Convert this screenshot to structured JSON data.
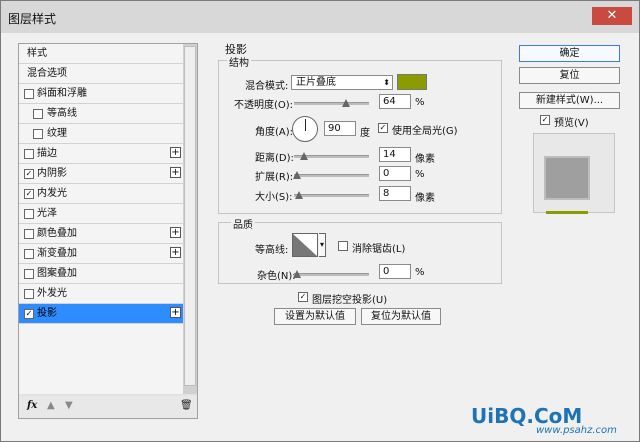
{
  "window": {
    "title": "图层样式",
    "close_symbol": "✕"
  },
  "sidebar": {
    "items": [
      {
        "label": "样式",
        "checkbox": false,
        "checked": false,
        "plus": false,
        "selected": false
      },
      {
        "label": "混合选项",
        "checkbox": false,
        "checked": false,
        "plus": false,
        "selected": false
      },
      {
        "label": "斜面和浮雕",
        "checkbox": true,
        "checked": false,
        "plus": false,
        "selected": false
      },
      {
        "label": "等高线",
        "checkbox": true,
        "checked": false,
        "plus": false,
        "selected": false,
        "indent": true
      },
      {
        "label": "纹理",
        "checkbox": true,
        "checked": false,
        "plus": false,
        "selected": false,
        "indent": true
      },
      {
        "label": "描边",
        "checkbox": true,
        "checked": false,
        "plus": true,
        "selected": false
      },
      {
        "label": "内阴影",
        "checkbox": true,
        "checked": true,
        "plus": true,
        "selected": false
      },
      {
        "label": "内发光",
        "checkbox": true,
        "checked": true,
        "plus": false,
        "selected": false
      },
      {
        "label": "光泽",
        "checkbox": true,
        "checked": false,
        "plus": false,
        "selected": false
      },
      {
        "label": "颜色叠加",
        "checkbox": true,
        "checked": false,
        "plus": true,
        "selected": false
      },
      {
        "label": "渐变叠加",
        "checkbox": true,
        "checked": false,
        "plus": true,
        "selected": false
      },
      {
        "label": "图案叠加",
        "checkbox": true,
        "checked": false,
        "plus": false,
        "selected": false
      },
      {
        "label": "外发光",
        "checkbox": true,
        "checked": false,
        "plus": false,
        "selected": false
      },
      {
        "label": "投影",
        "checkbox": true,
        "checked": true,
        "plus": true,
        "selected": true
      }
    ],
    "footer": {
      "fx": "fx",
      "up": "▲",
      "down": "▼",
      "trash": "🗑"
    }
  },
  "panel": {
    "title": "投影",
    "structure_title": "结构",
    "quality_title": "品质",
    "blend_mode_label": "混合模式:",
    "blend_mode_value": "正片叠底",
    "opacity_label": "不透明度(O):",
    "opacity_value": "64",
    "angle_label": "角度(A):",
    "angle_value": "90",
    "angle_unit": "度",
    "use_global_light_label": "使用全局光(G)",
    "distance_label": "距离(D):",
    "distance_value": "14",
    "size_unit": "像素",
    "spread_label": "扩展(R):",
    "spread_value": "0",
    "size_label": "大小(S):",
    "size_value": "8",
    "percent": "%",
    "contour_label": "等高线:",
    "antialias_label": "消除锯齿(L)",
    "noise_label": "杂色(N):",
    "noise_value": "0",
    "knockout_label": "图层挖空投影(U)",
    "set_default_label": "设置为默认值",
    "reset_default_label": "复位为默认值",
    "color": "#8c9b00"
  },
  "right": {
    "ok": "确定",
    "reset": "复位",
    "new_style": "新建样式(W)...",
    "preview": "预览(V)"
  },
  "watermark": {
    "main": "UiBQ.CoM",
    "sub": "www.psahz.com"
  }
}
